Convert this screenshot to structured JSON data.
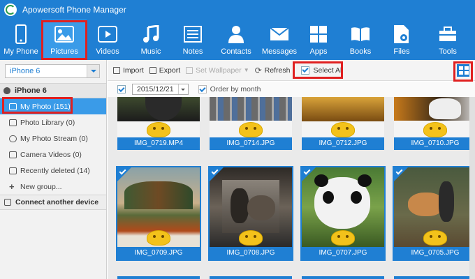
{
  "app": {
    "title": "Apowersoft Phone Manager"
  },
  "toolbar": {
    "items": [
      {
        "label": "My Phone",
        "icon": "phone-icon"
      },
      {
        "label": "Pictures",
        "icon": "picture-icon",
        "active": true
      },
      {
        "label": "Videos",
        "icon": "video-icon"
      },
      {
        "label": "Music",
        "icon": "music-icon"
      },
      {
        "label": "Notes",
        "icon": "notes-icon"
      },
      {
        "label": "Contacts",
        "icon": "contacts-icon"
      },
      {
        "label": "Messages",
        "icon": "messages-icon"
      },
      {
        "label": "Apps",
        "icon": "apps-icon"
      },
      {
        "label": "Books",
        "icon": "books-icon"
      },
      {
        "label": "Files",
        "icon": "files-icon"
      },
      {
        "label": "Tools",
        "icon": "tools-icon"
      }
    ]
  },
  "sidebar": {
    "device_select": "iPhone 6",
    "device_name": "iPhone 6",
    "items": [
      {
        "label": "My Photo (151)",
        "active": true
      },
      {
        "label": "Photo Library (0)"
      },
      {
        "label": "My Photo Stream (0)"
      },
      {
        "label": "Camera Videos (0)"
      },
      {
        "label": "Recently deleted (14)"
      },
      {
        "label": "New group..."
      }
    ],
    "connect": "Connect another device"
  },
  "actions": {
    "import": "Import",
    "export": "Export",
    "set_wallpaper": "Set Wallpaper",
    "refresh": "Refresh",
    "select_all": "Select All"
  },
  "datebar": {
    "date": "2015/12/21",
    "order_by_month": "Order by month"
  },
  "photos": [
    {
      "name": "IMG_0719.MP4",
      "selected": false
    },
    {
      "name": "IMG_0714.JPG",
      "selected": false
    },
    {
      "name": "IMG_0712.JPG",
      "selected": false
    },
    {
      "name": "IMG_0710.JPG",
      "selected": false
    },
    {
      "name": "IMG_0709.JPG",
      "selected": true
    },
    {
      "name": "IMG_0708.JPG",
      "selected": true
    },
    {
      "name": "IMG_0707.JPG",
      "selected": true
    },
    {
      "name": "IMG_0705.JPG",
      "selected": true
    }
  ],
  "colors": {
    "accent": "#1f7fd3",
    "highlight": "#e02020",
    "active_nav": "#3a9be8"
  }
}
